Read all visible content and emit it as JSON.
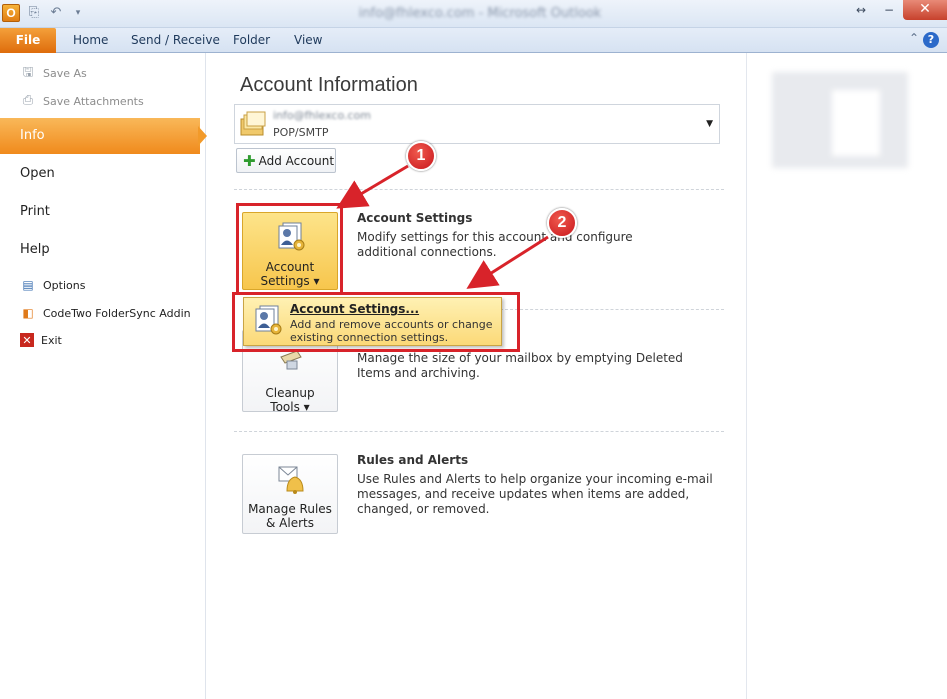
{
  "window": {
    "title": "info@fhlexco.com - Microsoft Outlook",
    "app_icon_letter": "O",
    "controls": [
      "↔",
      "−",
      "✕"
    ]
  },
  "ribbon": {
    "file_tab": "File",
    "tabs": [
      "Home",
      "Send / Receive",
      "Folder",
      "View"
    ],
    "help": "?"
  },
  "nav": {
    "save_as": "Save As",
    "save_attachments": "Save Attachments",
    "info": "Info",
    "open": "Open",
    "print": "Print",
    "help": "Help",
    "options": "Options",
    "codetwo": "CodeTwo FolderSync Addin",
    "exit": "Exit"
  },
  "main": {
    "heading": "Account Information",
    "account": {
      "email": "info@fhlexco.com",
      "type": "POP/SMTP"
    },
    "add_account": "Add Account",
    "account_settings_btn": {
      "line1": "Account",
      "line2": "Settings ▾"
    },
    "account_settings": {
      "title": "Account Settings",
      "desc": "Modify settings for this account and configure additional connections."
    },
    "popup": {
      "title": "Account Settings...",
      "desc": "Add and remove accounts or change existing connection settings."
    },
    "cleanup_btn": {
      "line1": "Cleanup",
      "line2": "Tools ▾"
    },
    "cleanup_desc": "Manage the size of your mailbox by emptying Deleted Items and archiving.",
    "rules_btn": {
      "line1": "Manage Rules",
      "line2": "& Alerts"
    },
    "rules": {
      "title": "Rules and Alerts",
      "desc": "Use Rules and Alerts to help organize your incoming e-mail messages, and receive updates when items are added, changed, or removed."
    }
  },
  "annotations": {
    "badge1": "1",
    "badge2": "2"
  },
  "colors": {
    "accent_orange": "#f08a1c",
    "annotation_red": "#d8232a",
    "highlight_yellow": "#fbd978"
  }
}
